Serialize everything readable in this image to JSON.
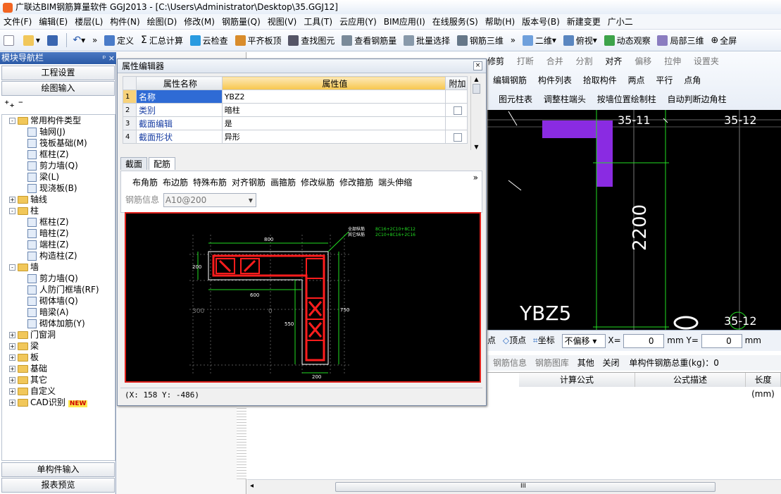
{
  "window": {
    "title": "广联达BIM钢筋算量软件 GGJ2013 - [C:\\Users\\Administrator\\Desktop\\35.GGJ12]"
  },
  "menubar": [
    "文件(F)",
    "编辑(E)",
    "楼层(L)",
    "构件(N)",
    "绘图(D)",
    "修改(M)",
    "钢筋量(Q)",
    "视图(V)",
    "工具(T)",
    "云应用(Y)",
    "BIM应用(I)",
    "在线服务(S)",
    "帮助(H)",
    "版本号(B)",
    "新建变更",
    "广小二"
  ],
  "toolbar": {
    "define": "定义",
    "sum_calc": "汇总计算",
    "cloud_check": "云检查",
    "align_top": "平齐板顶",
    "find_element": "查找图元",
    "view_rebar": "查看钢筋量",
    "batch_select": "批量选择",
    "rebar_3d": "钢筋三维",
    "view_2d": "二维",
    "view_top": "俯视",
    "dynamic_view": "动态观察",
    "local_3d": "局部三维",
    "fullscreen": "全屏",
    "more": "»"
  },
  "nav": {
    "title": "模块导航栏",
    "pin": "ᵖ ×",
    "project_settings": "工程设置",
    "drawing_input": "绘图输入",
    "single_input": "单构件输入",
    "report_preview": "报表预览",
    "tree": [
      {
        "label": "常用构件类型",
        "level": 0,
        "type": "folder",
        "sign": "-"
      },
      {
        "label": "轴网(J)",
        "level": 1,
        "type": "item"
      },
      {
        "label": "筏板基础(M)",
        "level": 1,
        "type": "item"
      },
      {
        "label": "框柱(Z)",
        "level": 1,
        "type": "item"
      },
      {
        "label": "剪力墙(Q)",
        "level": 1,
        "type": "item"
      },
      {
        "label": "梁(L)",
        "level": 1,
        "type": "item"
      },
      {
        "label": "现浇板(B)",
        "level": 1,
        "type": "item"
      },
      {
        "label": "轴线",
        "level": 0,
        "type": "folder",
        "sign": "+"
      },
      {
        "label": "柱",
        "level": 0,
        "type": "folder",
        "sign": "-"
      },
      {
        "label": "框柱(Z)",
        "level": 1,
        "type": "item"
      },
      {
        "label": "暗柱(Z)",
        "level": 1,
        "type": "item"
      },
      {
        "label": "端柱(Z)",
        "level": 1,
        "type": "item"
      },
      {
        "label": "构造柱(Z)",
        "level": 1,
        "type": "item"
      },
      {
        "label": "墙",
        "level": 0,
        "type": "folder",
        "sign": "-"
      },
      {
        "label": "剪力墙(Q)",
        "level": 1,
        "type": "item"
      },
      {
        "label": "人防门框墙(RF)",
        "level": 1,
        "type": "item"
      },
      {
        "label": "砌体墙(Q)",
        "level": 1,
        "type": "item"
      },
      {
        "label": "暗梁(A)",
        "level": 1,
        "type": "item"
      },
      {
        "label": "砌体加筋(Y)",
        "level": 1,
        "type": "item"
      },
      {
        "label": "门窗洞",
        "level": 0,
        "type": "folder",
        "sign": "+"
      },
      {
        "label": "梁",
        "level": 0,
        "type": "folder",
        "sign": "+"
      },
      {
        "label": "板",
        "level": 0,
        "type": "folder",
        "sign": "+"
      },
      {
        "label": "基础",
        "level": 0,
        "type": "folder",
        "sign": "+"
      },
      {
        "label": "其它",
        "level": 0,
        "type": "folder",
        "sign": "+"
      },
      {
        "label": "自定义",
        "level": 0,
        "type": "folder",
        "sign": "+"
      },
      {
        "label": "CAD识别",
        "level": 0,
        "type": "folder",
        "sign": "+",
        "badge": "NEW"
      }
    ]
  },
  "prop_editor": {
    "title": "属性编辑器",
    "close": "×",
    "col_name": "属性名称",
    "col_value": "属性值",
    "col_extra": "附加",
    "rows": [
      {
        "idx": "1",
        "name": "名称",
        "value": "YBZ2",
        "check": false
      },
      {
        "idx": "2",
        "name": "类别",
        "value": "暗柱",
        "check": true
      },
      {
        "idx": "3",
        "name": "截面编辑",
        "value": "是",
        "check": false
      },
      {
        "idx": "4",
        "name": "截面形状",
        "value": "异形",
        "check": true
      }
    ],
    "tabs": [
      "截面",
      "配筋"
    ],
    "sub_toolbar": [
      "布角筋",
      "布边筋",
      "特殊布筋",
      "对齐钢筋",
      "画箍筋",
      "修改纵筋",
      "修改箍筋",
      "端头伸缩"
    ],
    "rebar_info_label": "钢筋信息",
    "rebar_info_value": "A10@200",
    "status": "(X: 158 Y: -486)"
  },
  "section_drawing": {
    "legend1_label": "全部纵筋",
    "legend1_value": "8C16+2C10+8C12",
    "legend2_label": "其它纵筋",
    "legend2_value": "2C10+8C16+2C16",
    "dims": [
      "800",
      "200",
      "600",
      "300",
      "0",
      "550",
      "750",
      "200"
    ]
  },
  "right_toolbar": {
    "row0": [
      "修剪",
      "打断",
      "合并",
      "分割",
      "对齐",
      "偏移",
      "拉伸",
      "设置夹"
    ],
    "row1": [
      "编辑钢筋",
      "构件列表",
      "拾取构件",
      "两点",
      "平行",
      "点角"
    ],
    "row2": [
      "图元柱表",
      "调整柱端头",
      "按墙位置绘制柱",
      "自动判断边角柱"
    ]
  },
  "cad_view": {
    "labels": [
      "35-11",
      "35-12",
      "2200",
      "YBZ5",
      "35-12"
    ],
    "col_color": "#8a2be2"
  },
  "snap": {
    "point": "点",
    "vertex": "顶点",
    "coord": "坐标",
    "offset": "不偏移",
    "x_label": "X=",
    "x_value": "0",
    "x_unit": "mm",
    "y_label": "Y=",
    "y_value": "0",
    "y_unit": "mm"
  },
  "rebar_bar": {
    "info": "钢筋信息",
    "gallery": "钢筋图库",
    "other": "其他",
    "close": "关闭",
    "total_label": "单构件钢筋总重(kg)：0"
  },
  "bottom_grid": {
    "headers": [
      "计算公式",
      "公式描述",
      "长度(mm)"
    ]
  },
  "hscroll_grip": "III"
}
